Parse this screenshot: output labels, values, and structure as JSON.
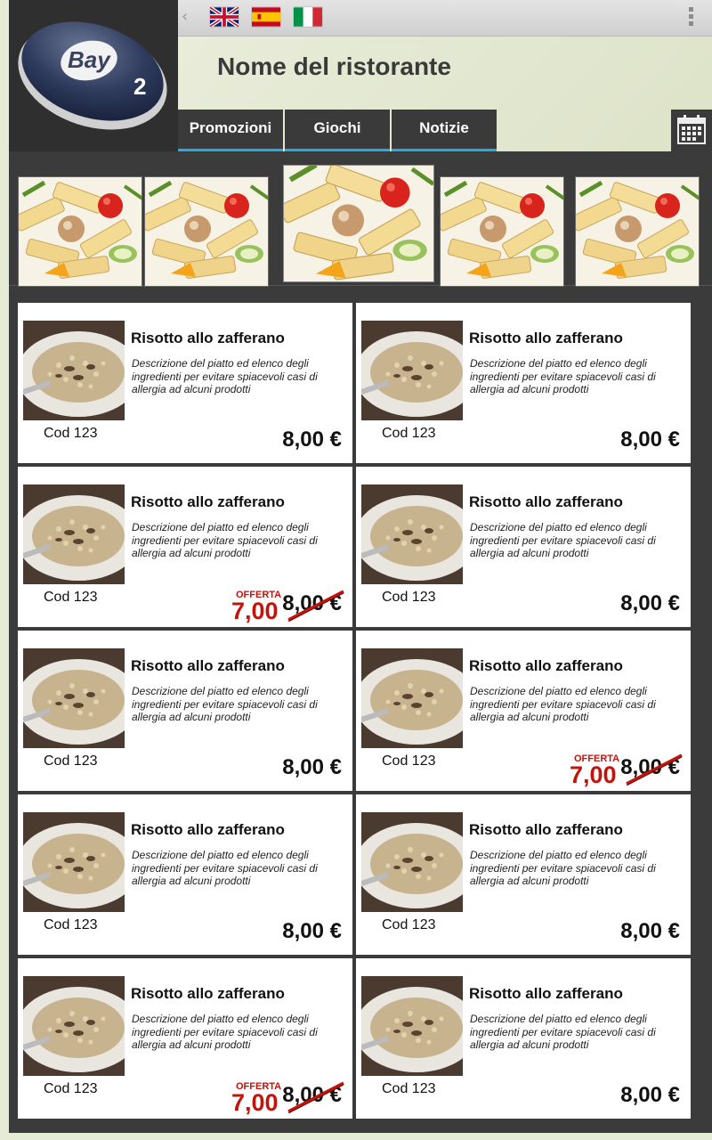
{
  "header": {
    "restaurant_name": "Nome del ristorante"
  },
  "logo_text": "Bay2",
  "topbar": {
    "languages": [
      "english-flag",
      "spanish-flag",
      "italian-flag"
    ]
  },
  "tabs": [
    {
      "label": "Promozioni"
    },
    {
      "label": "Giochi"
    },
    {
      "label": "Notizie"
    }
  ],
  "colors": {
    "tab_accent": "#27a9e1",
    "offer_red": "#c0140c"
  },
  "dishes": [
    {
      "title": "Risotto allo zafferano",
      "desc": "Descrizione del piatto ed elenco degli ingredienti per evitare spiacevoli casi di allergia ad alcuni prodotti",
      "code": "Cod 123",
      "price": "8,00 €"
    },
    {
      "title": "Risotto allo zafferano",
      "desc": "Descrizione del piatto ed elenco degli ingredienti per evitare spiacevoli casi di allergia ad alcuni prodotti",
      "code": "Cod 123",
      "price": "8,00 €"
    },
    {
      "title": "Risotto allo zafferano",
      "desc": "Descrizione del piatto ed elenco degli ingredienti per evitare spiacevoli casi di allergia ad alcuni prodotti",
      "code": "Cod 123",
      "price": "8,00 €",
      "offer_label": "OFFERTA",
      "offer_price": "7,00"
    },
    {
      "title": "Risotto allo zafferano",
      "desc": "Descrizione del piatto ed elenco degli ingredienti per evitare spiacevoli casi di allergia ad alcuni prodotti",
      "code": "Cod 123",
      "price": "8,00 €"
    },
    {
      "title": "Risotto allo zafferano",
      "desc": "Descrizione del piatto ed elenco degli ingredienti per evitare spiacevoli casi di allergia ad alcuni prodotti",
      "code": "Cod 123",
      "price": "8,00 €"
    },
    {
      "title": "Risotto allo zafferano",
      "desc": "Descrizione del piatto ed elenco degli ingredienti per evitare spiacevoli casi di allergia ad alcuni prodotti",
      "code": "Cod 123",
      "price": "8,00 €",
      "offer_label": "OFFERTA",
      "offer_price": "7,00"
    },
    {
      "title": "Risotto allo zafferano",
      "desc": "Descrizione del piatto ed elenco degli ingredienti per evitare spiacevoli casi di allergia ad alcuni prodotti",
      "code": "Cod 123",
      "price": "8,00 €"
    },
    {
      "title": "Risotto allo zafferano",
      "desc": "Descrizione del piatto ed elenco degli ingredienti per evitare spiacevoli casi di allergia ad alcuni prodotti",
      "code": "Cod 123",
      "price": "8,00 €"
    },
    {
      "title": "Risotto allo zafferano",
      "desc": "Descrizione del piatto ed elenco degli ingredienti per evitare spiacevoli casi di allergia ad alcuni prodotti",
      "code": "Cod 123",
      "price": "8,00 €",
      "offer_label": "OFFERTA",
      "offer_price": "7,00"
    },
    {
      "title": "Risotto allo zafferano",
      "desc": "Descrizione del piatto ed elenco degli ingredienti per evitare spiacevoli casi di allergia ad alcuni prodotti",
      "code": "Cod 123",
      "price": "8,00 €"
    }
  ]
}
